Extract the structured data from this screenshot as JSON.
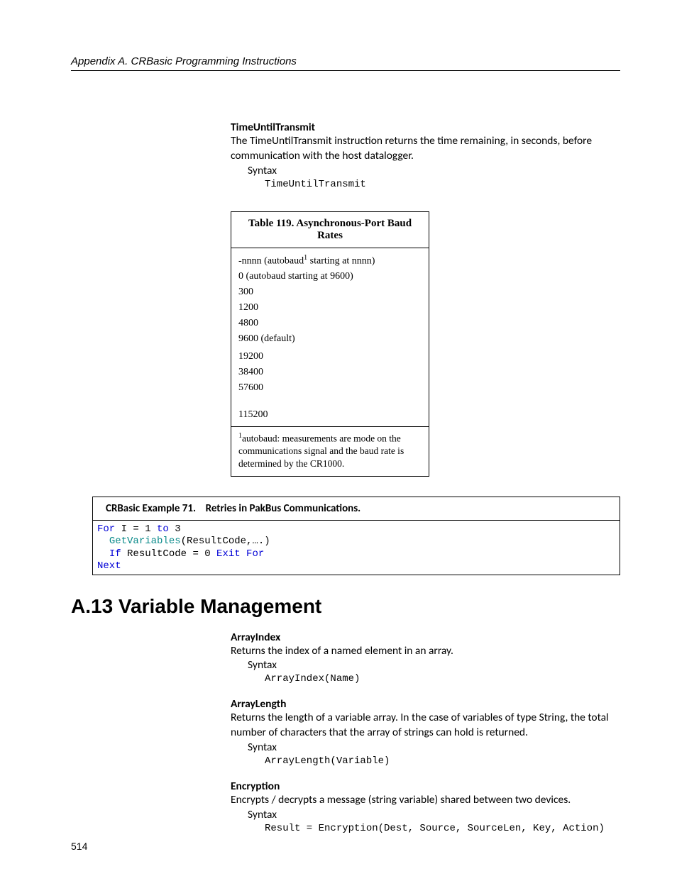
{
  "header": {
    "text": "Appendix A.  CRBasic Programming Instructions"
  },
  "tut": {
    "title": "TimeUntilTransmit",
    "desc": "The TimeUntilTransmit instruction returns the time remaining, in seconds, before communication with the host datalogger.",
    "syntax_label": "Syntax",
    "syntax_code": "TimeUntilTransmit"
  },
  "table": {
    "caption": "Table 119. Asynchronous-Port Baud Rates",
    "rows": [
      {
        "pre": "-nnnn (autobaud",
        "sup": "1",
        "post": " starting at nnnn)"
      },
      {
        "text": "0 (autobaud starting at 9600)"
      },
      {
        "text": "300"
      },
      {
        "text": "1200"
      },
      {
        "text": "4800"
      },
      {
        "text": "9600 (default)"
      },
      {
        "text": "19200"
      },
      {
        "text": "38400"
      },
      {
        "text": "57600"
      },
      {
        "text": ""
      },
      {
        "text": "115200"
      }
    ],
    "footnote_sup": "1",
    "footnote": "autobaud: measurements are mode on the communications signal and the baud rate is determined by the CR1000."
  },
  "example": {
    "label": "CRBasic Example 71.",
    "title": "Retries in PakBus Communications.",
    "code": {
      "l1a": "For",
      "l1b": " I = 1 ",
      "l1c": "to",
      "l1d": " 3",
      "l2a": "  ",
      "l2b": "GetVariables",
      "l2c": "(ResultCode,….)",
      "l3a": "  ",
      "l3b": "If",
      "l3c": " ResultCode = 0 ",
      "l3d": "Exit For",
      "l4": "Next"
    }
  },
  "section": {
    "heading": "A.13 Variable Management"
  },
  "ai": {
    "title": "ArrayIndex",
    "desc": "Returns the index of a named element in an array.",
    "syntax_label": "Syntax",
    "syntax_code": "ArrayIndex(Name)"
  },
  "al": {
    "title": "ArrayLength",
    "desc": "Returns the length of a variable array.  In the case of variables of type String, the total number of characters that the array of strings can hold is returned.",
    "syntax_label": "Syntax",
    "syntax_code": "ArrayLength(Variable)"
  },
  "enc": {
    "title": "Encryption",
    "desc": "Encrypts / decrypts a message (string variable) shared between two devices.",
    "syntax_label": "Syntax",
    "syntax_code": "Result = Encryption(Dest, Source, SourceLen, Key, Action)"
  },
  "page_number": "514"
}
